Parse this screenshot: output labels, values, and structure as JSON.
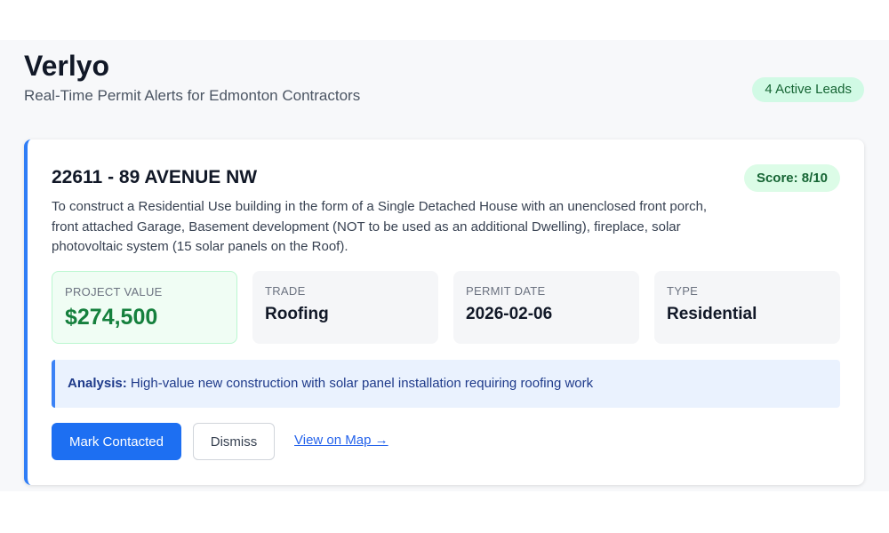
{
  "header": {
    "title": "Verlyo",
    "subtitle": "Real-Time Permit Alerts for Edmonton Contractors",
    "leads_badge": "4 Active Leads"
  },
  "lead": {
    "address": "22611 - 89 AVENUE NW",
    "score": "Score: 8/10",
    "description": "To construct a Residential Use building in the form of a Single Detached House with an unenclosed front porch, front attached Garage, Basement development (NOT to be used as an additional Dwelling), fireplace, solar photovoltaic system (15 solar panels on the Roof).",
    "stats": [
      {
        "label": "PROJECT VALUE",
        "value": "$274,500"
      },
      {
        "label": "TRADE",
        "value": "Roofing"
      },
      {
        "label": "PERMIT DATE",
        "value": "2026-02-06"
      },
      {
        "label": "TYPE",
        "value": "Residential"
      }
    ],
    "analysis_label": "Analysis:",
    "analysis_text": "High-value new construction with solar panel installation requiring roofing work",
    "actions": {
      "contacted": "Mark Contacted",
      "dismiss": "Dismiss",
      "map": "View on Map →"
    }
  },
  "colors": {
    "accent": "#1d6ff2",
    "card_border": "#2f7df6",
    "value_green": "#15803d",
    "badge_green_bg": "#d1fae5"
  }
}
